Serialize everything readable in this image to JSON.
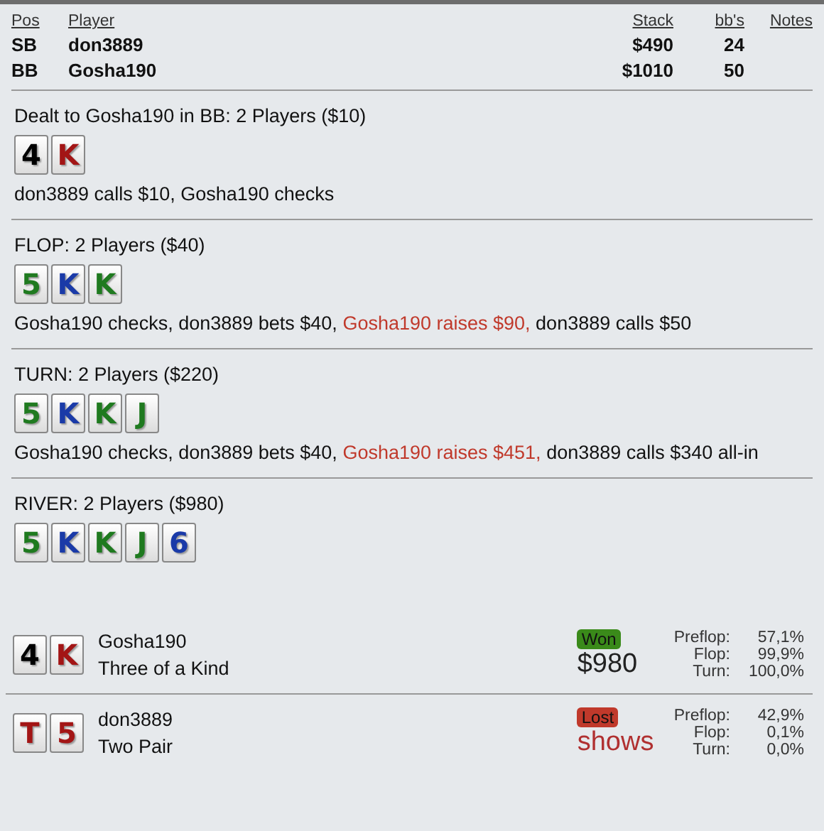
{
  "players_table": {
    "columns": [
      "Pos",
      "Player",
      "Stack",
      "bb's",
      "Notes"
    ],
    "rows": [
      {
        "pos": "SB",
        "player": "don3889",
        "stack": "$490",
        "bbs": "24"
      },
      {
        "pos": "BB",
        "player": "Gosha190",
        "stack": "$1010",
        "bbs": "50"
      }
    ]
  },
  "streets": [
    {
      "title": "Dealt to Gosha190 in BB: 2 Players ($10)",
      "cards": [
        {
          "rank": "4",
          "color": "#000000"
        },
        {
          "rank": "K",
          "color": "#a31515"
        }
      ],
      "actions": [
        {
          "text": "don3889 calls $10, Gosha190 checks",
          "highlight": false
        }
      ]
    },
    {
      "title": "FLOP: 2 Players ($40)",
      "cards": [
        {
          "rank": "5",
          "color": "#1f7a1f"
        },
        {
          "rank": "K",
          "color": "#1a3aa8"
        },
        {
          "rank": "K",
          "color": "#1f7a1f"
        }
      ],
      "actions": [
        {
          "text": "Gosha190 checks, don3889 bets $40,",
          "highlight": false
        },
        {
          "text": "Gosha190 raises $90,",
          "highlight": true
        },
        {
          "text": "don3889 calls $50",
          "highlight": false
        }
      ]
    },
    {
      "title": "TURN: 2 Players ($220)",
      "cards": [
        {
          "rank": "5",
          "color": "#1f7a1f"
        },
        {
          "rank": "K",
          "color": "#1a3aa8"
        },
        {
          "rank": "K",
          "color": "#1f7a1f"
        },
        {
          "rank": "J",
          "color": "#1f7a1f"
        }
      ],
      "actions": [
        {
          "text": "Gosha190 checks, don3889 bets $40,",
          "highlight": false
        },
        {
          "text": "Gosha190 raises $451,",
          "highlight": true
        },
        {
          "text": "don3889 calls $340 all-in",
          "highlight": false
        }
      ]
    },
    {
      "title": "RIVER: 2 Players ($980)",
      "cards": [
        {
          "rank": "5",
          "color": "#1f7a1f"
        },
        {
          "rank": "K",
          "color": "#1a3aa8"
        },
        {
          "rank": "K",
          "color": "#1f7a1f"
        },
        {
          "rank": "J",
          "color": "#1f7a1f"
        },
        {
          "rank": "6",
          "color": "#1a3aa8"
        }
      ]
    }
  ],
  "results": [
    {
      "cards": [
        {
          "rank": "4",
          "color": "#000000"
        },
        {
          "rank": "K",
          "color": "#a31515"
        }
      ],
      "player": "Gosha190",
      "hand": "Three of a Kind",
      "kind": "won",
      "badge": "Won",
      "amount": "$980",
      "equity": [
        {
          "label": "Preflop:",
          "value": "57,1%"
        },
        {
          "label": "Flop:",
          "value": "99,9%"
        },
        {
          "label": "Turn:",
          "value": "100,0%"
        }
      ]
    },
    {
      "cards": [
        {
          "rank": "T",
          "color": "#a31515"
        },
        {
          "rank": "5",
          "color": "#a31515"
        }
      ],
      "player": "don3889",
      "hand": "Two Pair",
      "kind": "lost",
      "badge": "Lost",
      "amount": "shows",
      "equity": [
        {
          "label": "Preflop:",
          "value": "42,9%"
        },
        {
          "label": "Flop:",
          "value": "0,1%"
        },
        {
          "label": "Turn:",
          "value": "0,0%"
        }
      ]
    }
  ]
}
